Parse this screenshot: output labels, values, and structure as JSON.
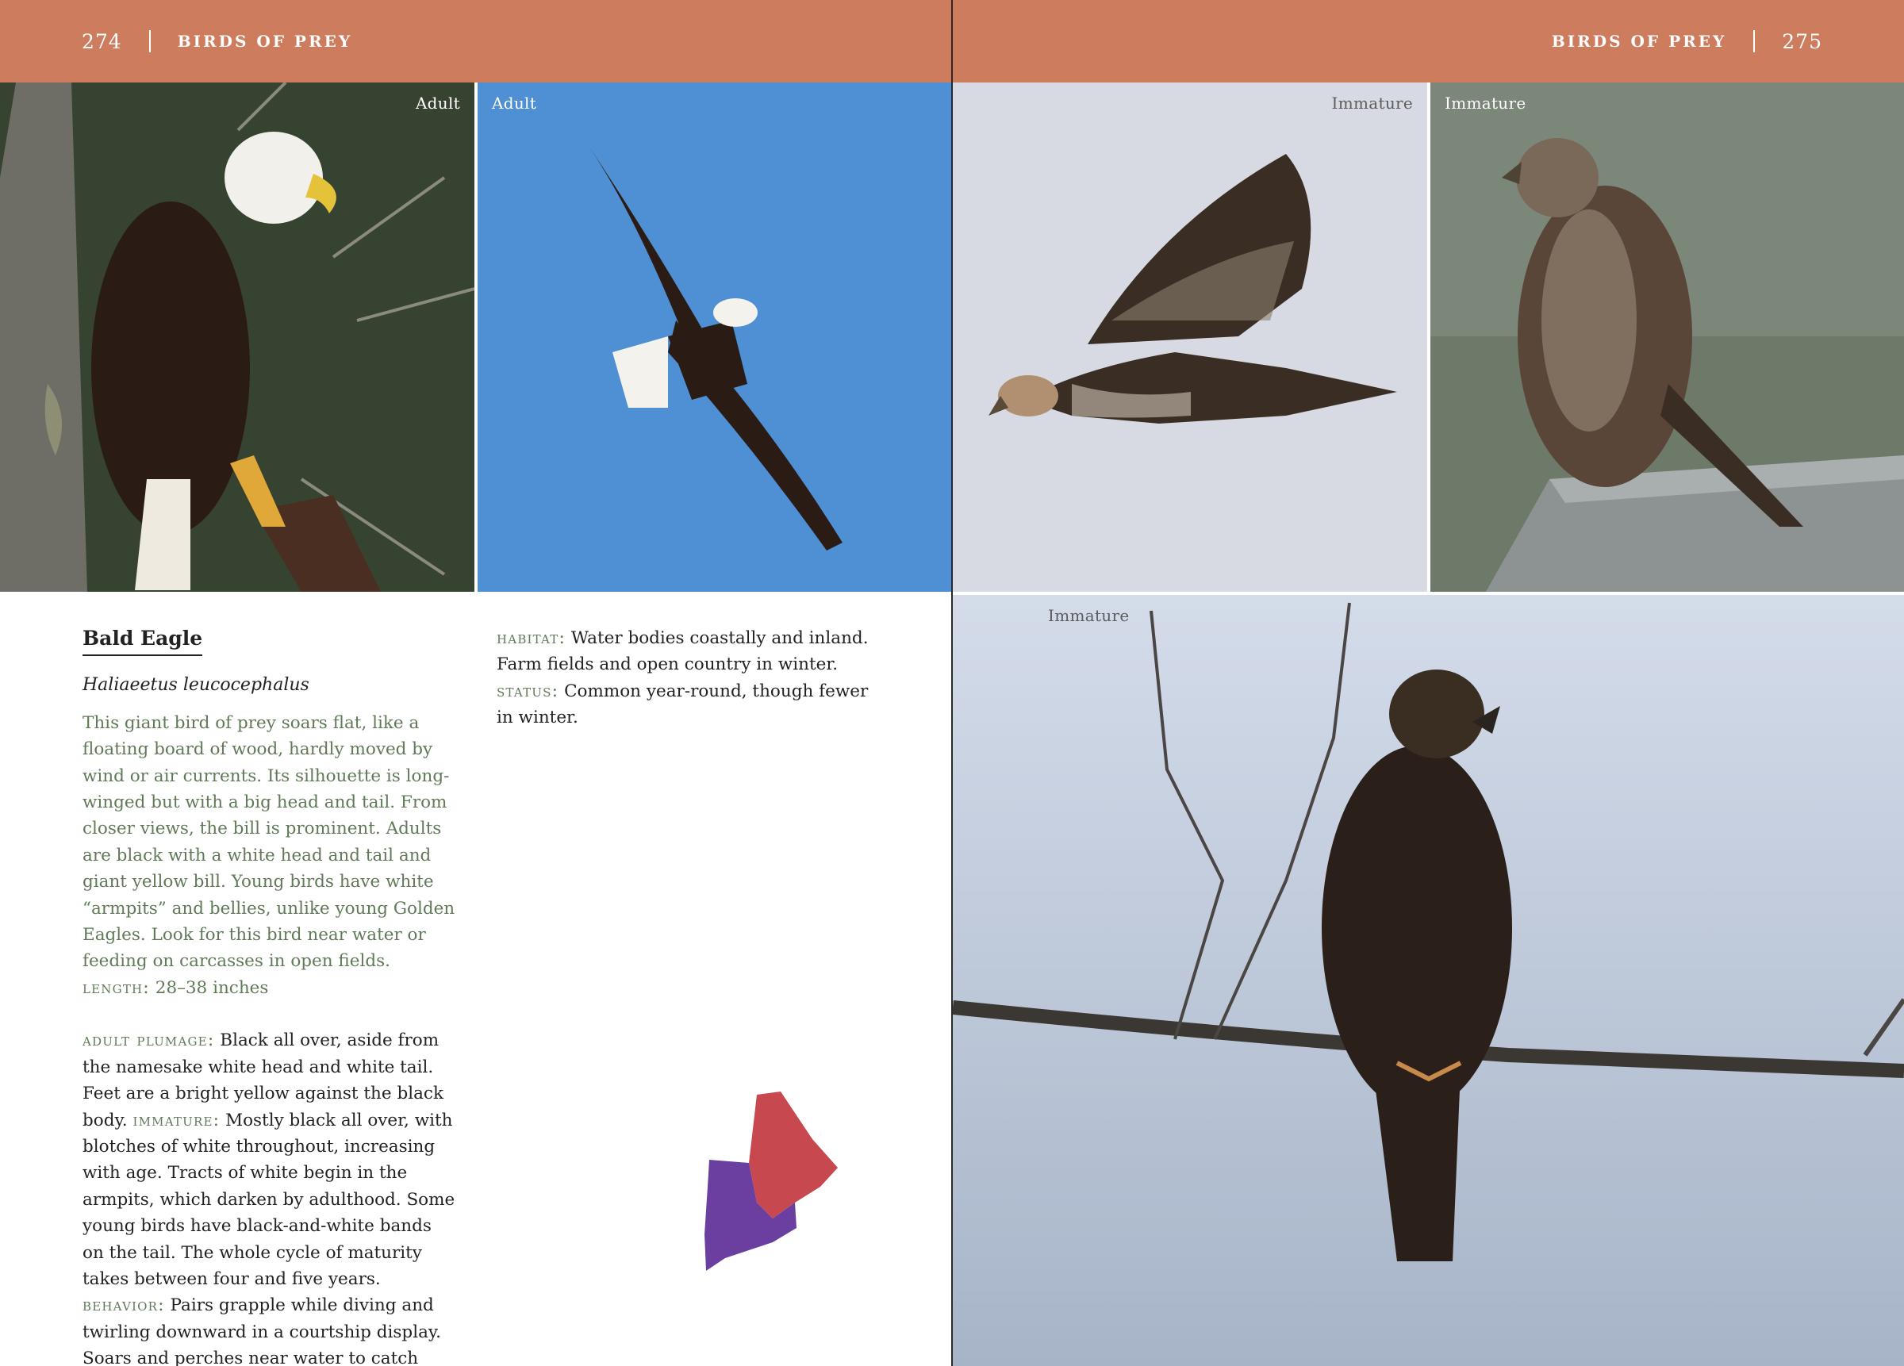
{
  "left_page": {
    "page_number": "274",
    "running_head": "BIRDS OF PREY",
    "photos": [
      {
        "caption": "Adult"
      },
      {
        "caption": "Adult"
      }
    ],
    "species": {
      "common_name": "Bald Eagle",
      "scientific_name": "Haliaeetus leucocephalus",
      "intro": "This giant bird of prey soars flat, like a floating board of wood, hardly moved by wind or air currents. Its silhouette is long-winged but with a big head and tail. From closer views, the bill is prominent. Adults are black with a white head and tail and giant yellow bill. Young birds have white “armpits” and bellies, unlike young Golden Eagles. Look for this bird near water or feeding on carcasses in open fields.",
      "length_label": "length:",
      "length_value": "28–38 inches",
      "adult_plumage_label": "adult plumage:",
      "adult_plumage_text": "Black all over, aside from the namesake white head and white tail. Feet are a bright yellow against the black body.",
      "immature_label": "immature:",
      "immature_text": "Mostly black all over, with blotches of white throughout, increasing with age. Tracts of white begin in the armpits, which darken by adulthood. Some young birds have black-and-white bands on the tail. The whole cycle of maturity takes between four and five years.",
      "behavior_label": "behavior:",
      "behavior_text": "Pairs grapple while diving and twirling downward in a courtship display. Soars and perches near water to catch fish. Frequently scavenges in winter, often on deer.",
      "habitat_label": "habitat:",
      "habitat_text": "Water bodies coastally and inland. Farm fields and open country in winter.",
      "status_label": "status:",
      "status_text": "Common year-round, though fewer in winter."
    },
    "range_map": {
      "icon": "new-england-range-map",
      "colors": {
        "year_round": "#6b3fa0",
        "other": "#c8484f"
      }
    }
  },
  "right_page": {
    "page_number": "275",
    "running_head": "BIRDS OF PREY",
    "photos": [
      {
        "caption": "Immature"
      },
      {
        "caption": "Immature"
      },
      {
        "caption": "Immature"
      }
    ]
  },
  "colors": {
    "header": "#cd7d5e",
    "label_green": "#5f7a57",
    "sky_blue": "#4f90d4"
  }
}
